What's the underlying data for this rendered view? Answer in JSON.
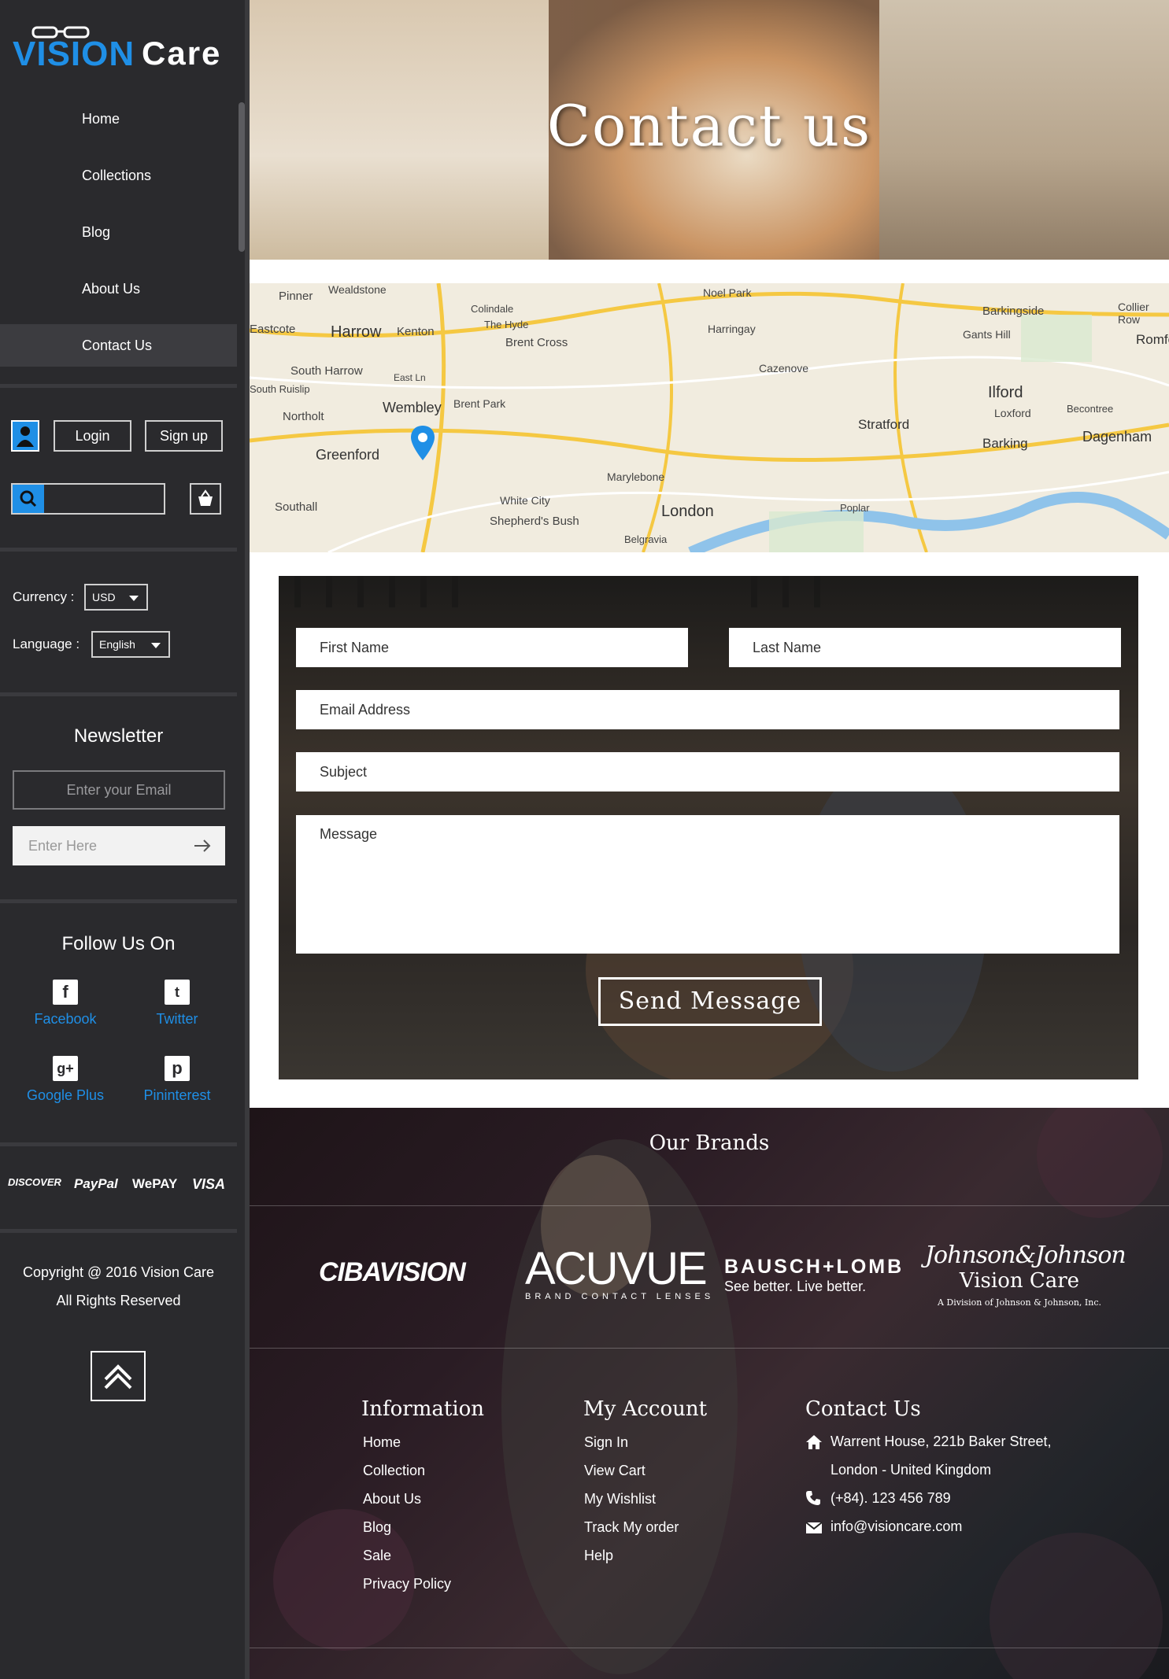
{
  "brand": {
    "name_part1": "VISION",
    "name_part2": "Care",
    "accent": "#1f8fe6"
  },
  "nav": [
    {
      "label": "Home"
    },
    {
      "label": "Collections"
    },
    {
      "label": "Blog"
    },
    {
      "label": "About Us"
    },
    {
      "label": "Contact Us",
      "active": true
    }
  ],
  "auth": {
    "login": "Login",
    "signup": "Sign up"
  },
  "settings": {
    "currency_label": "Currency :",
    "currency_value": "USD",
    "language_label": "Language :",
    "language_value": "English"
  },
  "newsletter": {
    "title": "Newsletter",
    "email_placeholder": "Enter your Email",
    "enter_placeholder": "Enter Here"
  },
  "follow": {
    "title": "Follow Us On",
    "items": [
      {
        "label": "Facebook",
        "icon": "f"
      },
      {
        "label": "Twitter",
        "icon": "t"
      },
      {
        "label": "Google Plus",
        "icon": "g+"
      },
      {
        "label": "Pininterest",
        "icon": "p"
      }
    ]
  },
  "payments": [
    "DISCOVER",
    "PayPal",
    "WePAY",
    "VISA"
  ],
  "copyright": {
    "line1": "Copyright @ 2016 Vision Care",
    "line2": "All Rights Reserved"
  },
  "hero": {
    "title": "Contact us"
  },
  "map": {
    "labels": [
      "Pinner",
      "Wealdstone",
      "Harrow",
      "Kenton",
      "Colindale",
      "The Hyde",
      "Brent Cross",
      "Noel Park",
      "Harringay",
      "Cazenove",
      "Barkingside",
      "Gants Hill",
      "Collier Row",
      "Romford",
      "Eastcote",
      "South Harrow",
      "East Ln",
      "Wembley",
      "Brent Park",
      "South Ruislip",
      "Northolt",
      "Greenford",
      "Stratford",
      "Ilford",
      "Loxford",
      "Barking",
      "Becontree",
      "Dagenham",
      "Southall",
      "White City",
      "Marylebone",
      "London",
      "Shepherd's Bush",
      "Poplar",
      "Belgravia"
    ]
  },
  "form": {
    "first_name": "First Name",
    "last_name": "Last Name",
    "email": "Email Address",
    "subject": "Subject",
    "message": "Message",
    "send": "Send Message"
  },
  "footer": {
    "brands_title": "Our Brands",
    "brands": [
      {
        "name": "CIBAVISION"
      },
      {
        "name": "ACUVUE",
        "sub": "BRAND CONTACT LENSES"
      },
      {
        "name": "BAUSCH+LOMB",
        "sub": "See better. Live better."
      },
      {
        "name": "Johnson&Johnson",
        "sub": "Vision Care",
        "sub2": "A Division of Johnson & Johnson, Inc."
      }
    ],
    "information": {
      "title": "Information",
      "links": [
        "Home",
        "Collection",
        "About Us",
        "Blog",
        "Sale",
        "Privacy Policy"
      ]
    },
    "account": {
      "title": "My Account",
      "links": [
        "Sign In",
        "View Cart",
        "My Wishlist",
        "Track My order",
        "Help"
      ]
    },
    "contact": {
      "title": "Contact Us",
      "address1": "Warrent House, 221b Baker Street,",
      "address2": "London - United Kingdom",
      "phone": "(+84). 123 456 789",
      "email": "info@visioncare.com"
    }
  }
}
